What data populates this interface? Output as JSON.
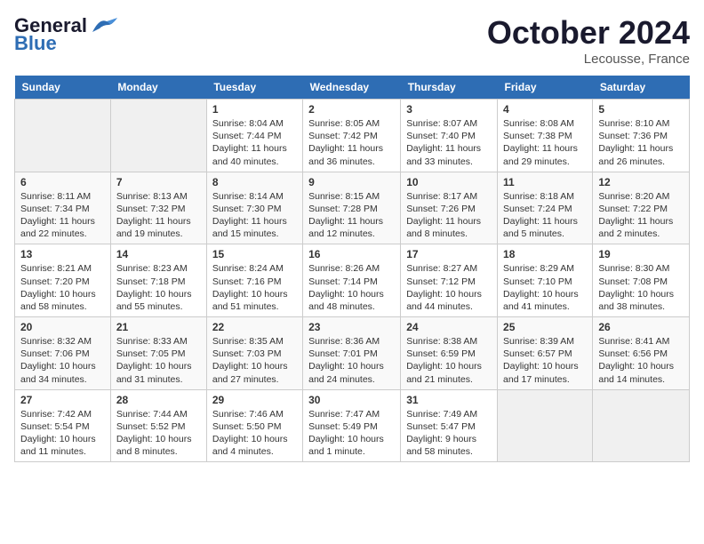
{
  "header": {
    "logo_general": "General",
    "logo_blue": "Blue",
    "month": "October 2024",
    "location": "Lecousse, France"
  },
  "columns": [
    "Sunday",
    "Monday",
    "Tuesday",
    "Wednesday",
    "Thursday",
    "Friday",
    "Saturday"
  ],
  "weeks": [
    [
      {
        "day": "",
        "sunrise": "",
        "sunset": "",
        "daylight": ""
      },
      {
        "day": "",
        "sunrise": "",
        "sunset": "",
        "daylight": ""
      },
      {
        "day": "1",
        "sunrise": "Sunrise: 8:04 AM",
        "sunset": "Sunset: 7:44 PM",
        "daylight": "Daylight: 11 hours and 40 minutes."
      },
      {
        "day": "2",
        "sunrise": "Sunrise: 8:05 AM",
        "sunset": "Sunset: 7:42 PM",
        "daylight": "Daylight: 11 hours and 36 minutes."
      },
      {
        "day": "3",
        "sunrise": "Sunrise: 8:07 AM",
        "sunset": "Sunset: 7:40 PM",
        "daylight": "Daylight: 11 hours and 33 minutes."
      },
      {
        "day": "4",
        "sunrise": "Sunrise: 8:08 AM",
        "sunset": "Sunset: 7:38 PM",
        "daylight": "Daylight: 11 hours and 29 minutes."
      },
      {
        "day": "5",
        "sunrise": "Sunrise: 8:10 AM",
        "sunset": "Sunset: 7:36 PM",
        "daylight": "Daylight: 11 hours and 26 minutes."
      }
    ],
    [
      {
        "day": "6",
        "sunrise": "Sunrise: 8:11 AM",
        "sunset": "Sunset: 7:34 PM",
        "daylight": "Daylight: 11 hours and 22 minutes."
      },
      {
        "day": "7",
        "sunrise": "Sunrise: 8:13 AM",
        "sunset": "Sunset: 7:32 PM",
        "daylight": "Daylight: 11 hours and 19 minutes."
      },
      {
        "day": "8",
        "sunrise": "Sunrise: 8:14 AM",
        "sunset": "Sunset: 7:30 PM",
        "daylight": "Daylight: 11 hours and 15 minutes."
      },
      {
        "day": "9",
        "sunrise": "Sunrise: 8:15 AM",
        "sunset": "Sunset: 7:28 PM",
        "daylight": "Daylight: 11 hours and 12 minutes."
      },
      {
        "day": "10",
        "sunrise": "Sunrise: 8:17 AM",
        "sunset": "Sunset: 7:26 PM",
        "daylight": "Daylight: 11 hours and 8 minutes."
      },
      {
        "day": "11",
        "sunrise": "Sunrise: 8:18 AM",
        "sunset": "Sunset: 7:24 PM",
        "daylight": "Daylight: 11 hours and 5 minutes."
      },
      {
        "day": "12",
        "sunrise": "Sunrise: 8:20 AM",
        "sunset": "Sunset: 7:22 PM",
        "daylight": "Daylight: 11 hours and 2 minutes."
      }
    ],
    [
      {
        "day": "13",
        "sunrise": "Sunrise: 8:21 AM",
        "sunset": "Sunset: 7:20 PM",
        "daylight": "Daylight: 10 hours and 58 minutes."
      },
      {
        "day": "14",
        "sunrise": "Sunrise: 8:23 AM",
        "sunset": "Sunset: 7:18 PM",
        "daylight": "Daylight: 10 hours and 55 minutes."
      },
      {
        "day": "15",
        "sunrise": "Sunrise: 8:24 AM",
        "sunset": "Sunset: 7:16 PM",
        "daylight": "Daylight: 10 hours and 51 minutes."
      },
      {
        "day": "16",
        "sunrise": "Sunrise: 8:26 AM",
        "sunset": "Sunset: 7:14 PM",
        "daylight": "Daylight: 10 hours and 48 minutes."
      },
      {
        "day": "17",
        "sunrise": "Sunrise: 8:27 AM",
        "sunset": "Sunset: 7:12 PM",
        "daylight": "Daylight: 10 hours and 44 minutes."
      },
      {
        "day": "18",
        "sunrise": "Sunrise: 8:29 AM",
        "sunset": "Sunset: 7:10 PM",
        "daylight": "Daylight: 10 hours and 41 minutes."
      },
      {
        "day": "19",
        "sunrise": "Sunrise: 8:30 AM",
        "sunset": "Sunset: 7:08 PM",
        "daylight": "Daylight: 10 hours and 38 minutes."
      }
    ],
    [
      {
        "day": "20",
        "sunrise": "Sunrise: 8:32 AM",
        "sunset": "Sunset: 7:06 PM",
        "daylight": "Daylight: 10 hours and 34 minutes."
      },
      {
        "day": "21",
        "sunrise": "Sunrise: 8:33 AM",
        "sunset": "Sunset: 7:05 PM",
        "daylight": "Daylight: 10 hours and 31 minutes."
      },
      {
        "day": "22",
        "sunrise": "Sunrise: 8:35 AM",
        "sunset": "Sunset: 7:03 PM",
        "daylight": "Daylight: 10 hours and 27 minutes."
      },
      {
        "day": "23",
        "sunrise": "Sunrise: 8:36 AM",
        "sunset": "Sunset: 7:01 PM",
        "daylight": "Daylight: 10 hours and 24 minutes."
      },
      {
        "day": "24",
        "sunrise": "Sunrise: 8:38 AM",
        "sunset": "Sunset: 6:59 PM",
        "daylight": "Daylight: 10 hours and 21 minutes."
      },
      {
        "day": "25",
        "sunrise": "Sunrise: 8:39 AM",
        "sunset": "Sunset: 6:57 PM",
        "daylight": "Daylight: 10 hours and 17 minutes."
      },
      {
        "day": "26",
        "sunrise": "Sunrise: 8:41 AM",
        "sunset": "Sunset: 6:56 PM",
        "daylight": "Daylight: 10 hours and 14 minutes."
      }
    ],
    [
      {
        "day": "27",
        "sunrise": "Sunrise: 7:42 AM",
        "sunset": "Sunset: 5:54 PM",
        "daylight": "Daylight: 10 hours and 11 minutes."
      },
      {
        "day": "28",
        "sunrise": "Sunrise: 7:44 AM",
        "sunset": "Sunset: 5:52 PM",
        "daylight": "Daylight: 10 hours and 8 minutes."
      },
      {
        "day": "29",
        "sunrise": "Sunrise: 7:46 AM",
        "sunset": "Sunset: 5:50 PM",
        "daylight": "Daylight: 10 hours and 4 minutes."
      },
      {
        "day": "30",
        "sunrise": "Sunrise: 7:47 AM",
        "sunset": "Sunset: 5:49 PM",
        "daylight": "Daylight: 10 hours and 1 minute."
      },
      {
        "day": "31",
        "sunrise": "Sunrise: 7:49 AM",
        "sunset": "Sunset: 5:47 PM",
        "daylight": "Daylight: 9 hours and 58 minutes."
      },
      {
        "day": "",
        "sunrise": "",
        "sunset": "",
        "daylight": ""
      },
      {
        "day": "",
        "sunrise": "",
        "sunset": "",
        "daylight": ""
      }
    ]
  ]
}
